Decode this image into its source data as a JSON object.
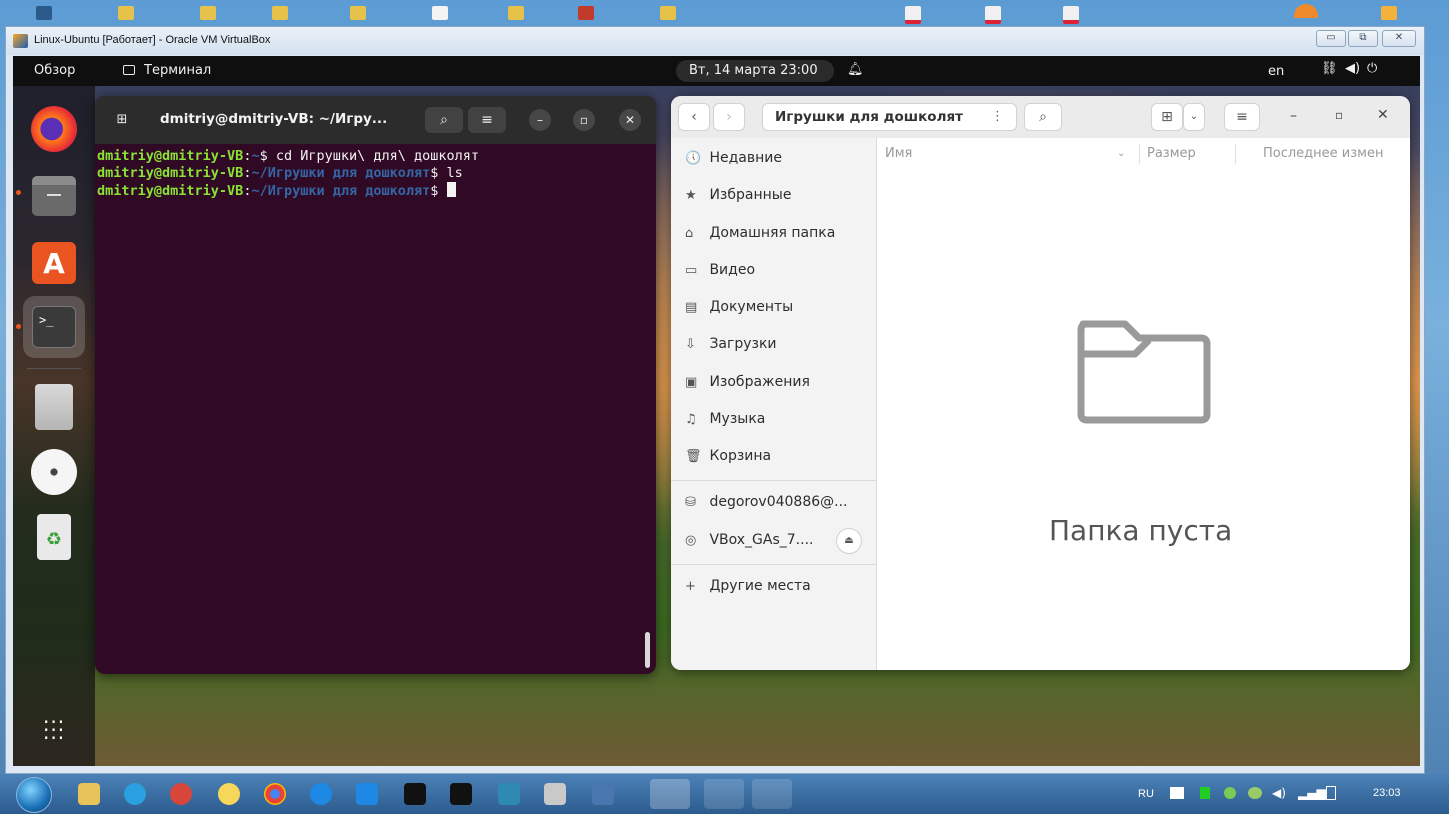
{
  "host": {
    "window_title": "Linux-Ubuntu [Работает] - Oracle VM VirtualBox",
    "taskbar_lang": "RU",
    "taskbar_clock": "23:03"
  },
  "guest": {
    "topbar": {
      "overview": "Обзор",
      "app_name": "Терминал",
      "datetime": "Вт, 14 марта  23:00",
      "lang": "en"
    },
    "terminal": {
      "title": "dmitriy@dmitriy-VB: ~/Игру...",
      "lines": [
        {
          "user": "dmitriy@dmitriy-VB",
          "path": "~",
          "cmd": "cd Игрушки\\ для\\ дошколят"
        },
        {
          "user": "dmitriy@dmitriy-VB",
          "path": "~/Игрушки для дошколят",
          "cmd": "ls"
        },
        {
          "user": "dmitriy@dmitriy-VB",
          "path": "~/Игрушки для дошколят",
          "cmd": ""
        }
      ]
    },
    "files": {
      "path": "Игрушки для дошколят",
      "columns": {
        "name": "Имя",
        "size": "Размер",
        "modified": "Последнее измен"
      },
      "sidebar": [
        {
          "icon": "🕔",
          "label": "Недавние"
        },
        {
          "icon": "★",
          "label": "Избранные"
        },
        {
          "icon": "⌂",
          "label": "Домашняя папка"
        },
        {
          "icon": "▭",
          "label": "Видео"
        },
        {
          "icon": "▤",
          "label": "Документы"
        },
        {
          "icon": "⇩",
          "label": "Загрузки"
        },
        {
          "icon": "▣",
          "label": "Изображения"
        },
        {
          "icon": "♫",
          "label": "Музыка"
        },
        {
          "icon": "🗑",
          "label": "Корзина"
        },
        {
          "icon": "⛁",
          "label": "degorov040886@..."
        },
        {
          "icon": "◎",
          "label": "VBox_GAs_7...."
        },
        {
          "icon": "+",
          "label": "Другие места"
        }
      ],
      "empty_text": "Папка пуста"
    }
  }
}
